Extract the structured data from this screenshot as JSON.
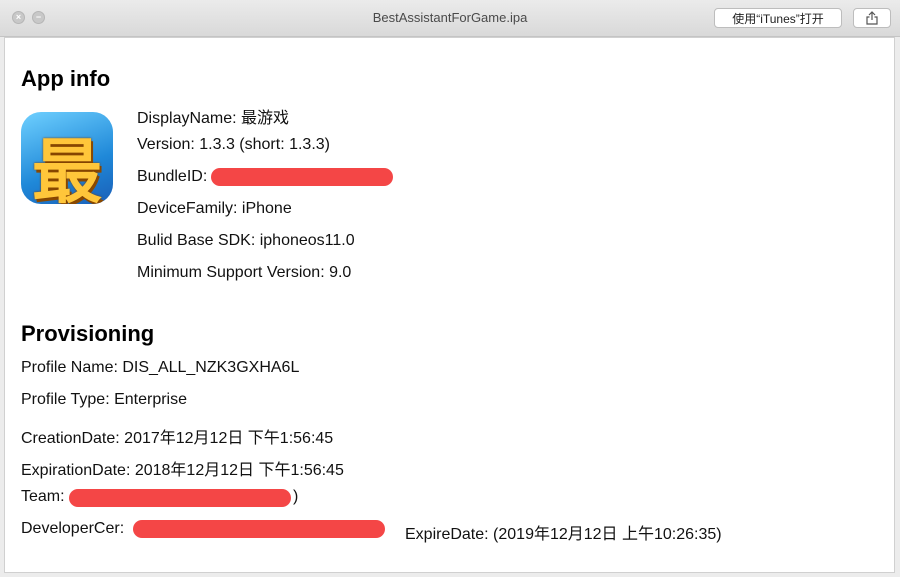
{
  "window": {
    "title": "BestAssistantForGame.ipa",
    "open_button_label": "使用“iTunes”打开",
    "controls": {
      "close_glyph": "×",
      "minimize_glyph": "−"
    }
  },
  "app_info": {
    "heading": "App info",
    "icon_glyph": "最",
    "display_name": "DisplayName: 最游戏",
    "version": "Version: 1.3.3 (short: 1.3.3)",
    "bundle_id": "BundleID: ",
    "device_family": "DeviceFamily: iPhone",
    "base_sdk": "Bulid Base SDK: iphoneos11.0",
    "min_version": "Minimum Support Version: 9.0"
  },
  "provisioning": {
    "heading": "Provisioning",
    "profile_name": "Profile Name: DIS_ALL_NZK3GXHA6L",
    "profile_type": "Profile Type: Enterprise",
    "creation_date": "CreationDate: 2017年12月12日 下午1:56:45",
    "expiration_date": "ExpirationDate: 2018年12月12日 下午1:56:45",
    "team": "Team: ",
    "team_suffix": ")",
    "developer_cer": "DeveloperCer: ",
    "expire_date": "ExpireDate: (2019年12月12日 上午10:26:35)"
  },
  "colors": {
    "redaction": "#f44646",
    "icon_bg": "#1f88d8",
    "icon_glyph": "#ffc63a"
  }
}
